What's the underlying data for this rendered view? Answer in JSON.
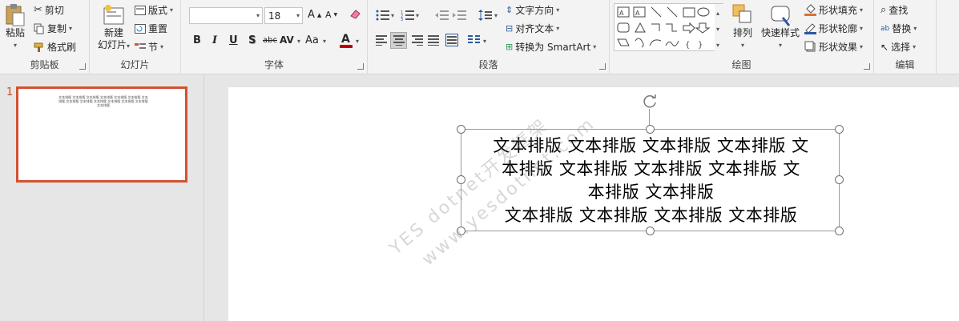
{
  "clipboard": {
    "paste": "粘贴",
    "cut": "剪切",
    "copy": "复制",
    "format_painter": "格式刷",
    "group": "剪贴板"
  },
  "slides": {
    "new_slide_1": "新建",
    "new_slide_2": "幻灯片",
    "layout": "版式",
    "reset": "重置",
    "section": "节",
    "group": "幻灯片"
  },
  "font": {
    "name_value": "",
    "size_value": "18",
    "group": "字体",
    "bold": "B",
    "italic": "I",
    "underline": "U",
    "shadow": "S",
    "strike": "abc",
    "spacing": "AV",
    "case": "Aa",
    "color": "A"
  },
  "paragraph": {
    "text_direction": "文字方向",
    "align_text": "对齐文本",
    "smartart": "转换为 SmartArt",
    "group": "段落"
  },
  "drawing": {
    "arrange": "排列",
    "quick_styles": "快速样式",
    "shape_fill": "形状填充",
    "shape_outline": "形状轮廓",
    "shape_effects": "形状效果",
    "group": "绘图"
  },
  "editing": {
    "find": "查找",
    "replace": "替换",
    "select": "选择",
    "group": "编辑"
  },
  "thumbnail": {
    "number": "1",
    "text": "文本排版 文本排版 文本排版 文本排版 文本排版 文本排版 文本排版 文本排版 文本排版 文本排版 文本排版 文本排版 文本排版 文本排版"
  },
  "textbox": {
    "line1": "文本排版 文本排版 文本排版 文本排版 文",
    "line2": "本排版 文本排版 文本排版 文本排版 文",
    "line3": "本排版 文本排版",
    "line4": "文本排版 文本排版 文本排版 文本排版"
  },
  "watermark": {
    "line1": "YES dotnet开发框架",
    "line2": "www.yesdotnet.com"
  },
  "colors": {
    "accent": "#d35230",
    "font_color_bar": "#c00000",
    "highlight": "#e8e8e8"
  }
}
